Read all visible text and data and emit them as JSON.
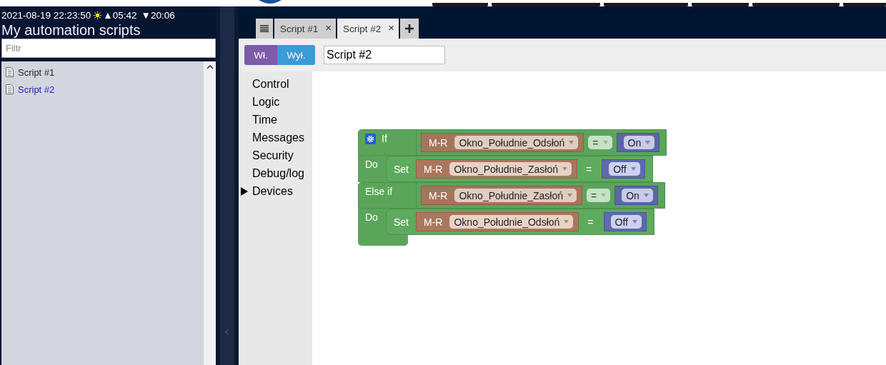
{
  "header": {
    "datetime": "2021-08-19 22:23:50",
    "sunrise": "▲05:42",
    "sunset": "▼20:06",
    "title": "My automation scripts"
  },
  "filter": {
    "placeholder": "Filtr"
  },
  "scripts": [
    {
      "label": "Script #1",
      "selected": false
    },
    {
      "label": "Script #2",
      "selected": true
    }
  ],
  "tabs": [
    {
      "label": "Script #1",
      "close": "×",
      "selected": false
    },
    {
      "label": "Script #2",
      "close": "×",
      "selected": true
    }
  ],
  "toolbar": {
    "buttons": [
      {
        "label": "Wł.",
        "color": "#7c5ba8"
      },
      {
        "label": "Wył.",
        "color": "#3b9bd6"
      }
    ],
    "script_name": "Script #2"
  },
  "categories": [
    {
      "label": "Control",
      "expandable": false
    },
    {
      "label": "Logic",
      "expandable": false
    },
    {
      "label": "Time",
      "expandable": false
    },
    {
      "label": "Messages",
      "expandable": false
    },
    {
      "label": "Security",
      "expandable": false
    },
    {
      "label": "Debug/log",
      "expandable": false
    },
    {
      "label": "Devices",
      "expandable": true
    }
  ],
  "program": {
    "clauses": [
      {
        "kind": "condition",
        "label": "If",
        "device_type": "M-R",
        "device": "Okno_Południe_Odsłoń",
        "operator": "=",
        "value": "On"
      },
      {
        "kind": "action",
        "label": "Do",
        "verb": "Set",
        "device_type": "M-R",
        "device": "Okno_Południe_Zasłoń",
        "operator": "=",
        "value": "Off"
      },
      {
        "kind": "condition",
        "label": "Else if",
        "device_type": "M-R",
        "device": "Okno_Południe_Zasłoń",
        "operator": "=",
        "value": "On"
      },
      {
        "kind": "action",
        "label": "Do",
        "verb": "Set",
        "device_type": "M-R",
        "device": "Okno_Południe_Odsłoń",
        "operator": "=",
        "value": "Off"
      }
    ]
  }
}
